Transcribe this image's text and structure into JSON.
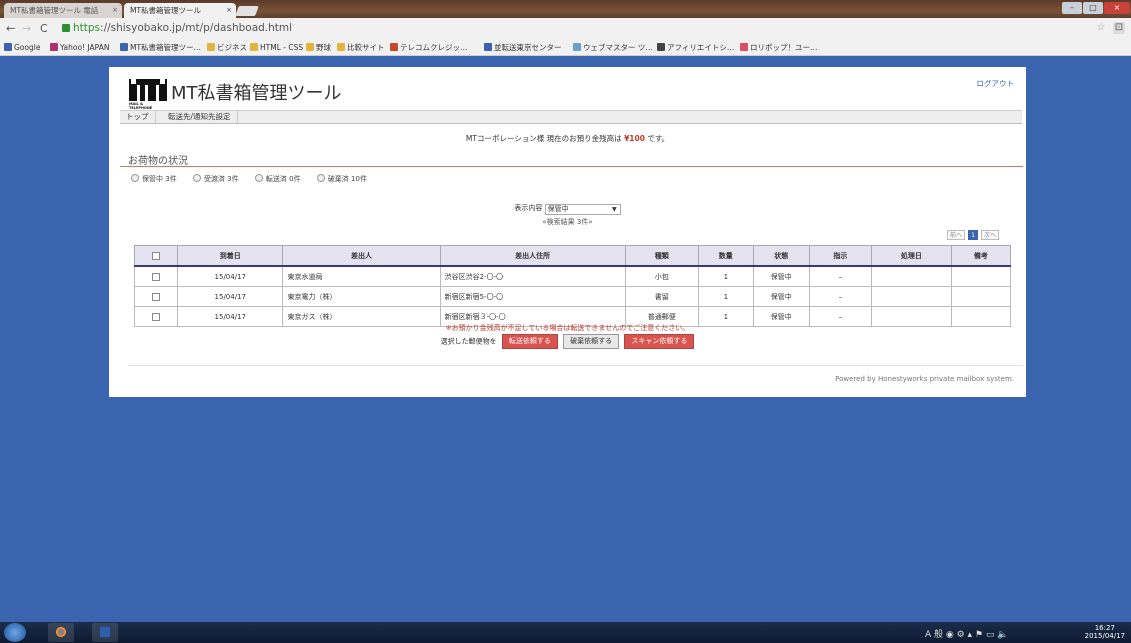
{
  "browser": {
    "tabs": [
      {
        "label": "MT私書箱管理ツール 電話"
      },
      {
        "label": "MT私書箱管理ツール"
      }
    ],
    "url_scheme": "https",
    "url_rest": "://shisyobako.jp/mt/p/dashboad.html",
    "bookmarks": [
      {
        "label": "Google",
        "color": "#3a64ad"
      },
      {
        "label": "Yahoo! JAPAN",
        "color": "#b0306b"
      },
      {
        "label": "MT私書箱管理ツー…",
        "color": "#3a64ad"
      },
      {
        "label": "ビジネス",
        "color": "#e2b43e"
      },
      {
        "label": "HTML - CSS",
        "color": "#e2b43e"
      },
      {
        "label": "野球",
        "color": "#e2b43e"
      },
      {
        "label": "比較サイト",
        "color": "#e2b43e"
      },
      {
        "label": "テレコムクレジッ…",
        "color": "#c04a2a"
      },
      {
        "label": "並転送東京センター",
        "color": "#3a64ad"
      },
      {
        "label": "ウェブマスター ツ…",
        "color": "#6aa0c8"
      },
      {
        "label": "アフィリエイトシ…",
        "color": "#444"
      },
      {
        "label": "ロリポップ！ユー…",
        "color": "#d94c6a"
      }
    ]
  },
  "header": {
    "logo_text": "MT",
    "logo_sub": "MAIL & TELEPHONE",
    "title": "MT私書箱管理ツール",
    "logout": "ログアウト"
  },
  "nav": [
    {
      "label": "トップ"
    },
    {
      "label": "転送先/通知先設定"
    }
  ],
  "notice": {
    "prefix": "MTコーポレーション様 現在のお預り金残高は",
    "amount": "¥100",
    "suffix": "です。"
  },
  "section_title": "お荷物の状況",
  "statuses": [
    {
      "label": "保管中",
      "count": "3件"
    },
    {
      "label": "受渡済",
      "count": "3件"
    },
    {
      "label": "転送済",
      "count": "0件"
    },
    {
      "label": "破棄済",
      "count": "10件"
    }
  ],
  "filter": {
    "label": "表示内容",
    "selected": "保管中"
  },
  "result_text": "«検索結果 3件»",
  "pagination": {
    "prev": "前へ",
    "current": "1",
    "next": "次へ"
  },
  "table": {
    "headers": [
      "",
      "到着日",
      "差出人",
      "差出人住所",
      "種類",
      "数量",
      "状態",
      "指示",
      "処理日",
      "備考"
    ],
    "rows": [
      {
        "date": "15/04/17",
        "sender": "東京水道局",
        "address": "渋谷区渋谷2-〇-〇",
        "type": "小包",
        "qty": "1",
        "status": "保管中",
        "instruction": "–",
        "processed": "",
        "note": ""
      },
      {
        "date": "15/04/17",
        "sender": "東京電力（株）",
        "address": "新宿区新宿5-〇-〇",
        "type": "書留",
        "qty": "1",
        "status": "保管中",
        "instruction": "–",
        "processed": "",
        "note": ""
      },
      {
        "date": "15/04/17",
        "sender": "東京ガス（株）",
        "address": "新宿区新宿３-〇-〇",
        "type": "普通郵便",
        "qty": "1",
        "status": "保管中",
        "instruction": "–",
        "processed": "",
        "note": ""
      }
    ]
  },
  "warning": "※お預かり金残高が不足している場合は転送できませんのでご注意ください。",
  "actions": {
    "label": "選択した郵便物を",
    "forward": "転送依頼する",
    "discard": "破棄依頼する",
    "scan": "スキャン依頼する"
  },
  "footer": "Powered by Honestyworks private mailbox system.",
  "taskbar": {
    "time": "16:27",
    "date": "2015/04/17",
    "ime": "A 般"
  },
  "colors": {
    "desktop": "#3a64ad",
    "accent_red": "#d9534f",
    "link_blue": "#3a64ad"
  }
}
